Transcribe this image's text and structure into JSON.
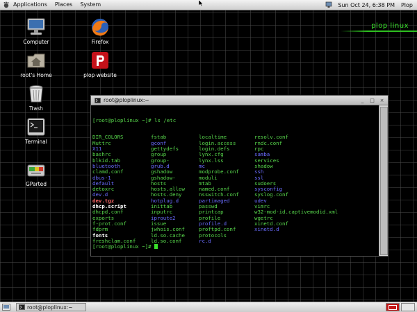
{
  "top_panel": {
    "menu": [
      "Applications",
      "Places",
      "System"
    ],
    "clock": "Sun Oct 24,  6:38 PM",
    "user": "Plop"
  },
  "desktop_icons": [
    {
      "label": "Computer"
    },
    {
      "label": "Firefox"
    },
    {
      "label": "root's Home"
    },
    {
      "label": "plop website"
    },
    {
      "label": "Trash"
    },
    {
      "label": "Terminal"
    },
    {
      "label": "GParted"
    }
  ],
  "brand": "plop linux",
  "terminal": {
    "title": "root@ploplinux:~",
    "prompt_line": "[root@ploplinux ~]# ls /etc",
    "final_prompt": "[root@ploplinux ~]# ",
    "rows": [
      [
        [
          "DIR_COLORS",
          "g"
        ],
        [
          "fstab",
          "g"
        ],
        [
          "localtime",
          "g"
        ],
        [
          "resolv.conf",
          "g"
        ]
      ],
      [
        [
          "Muttrc",
          "g"
        ],
        [
          "gconf",
          "b"
        ],
        [
          "login.access",
          "g"
        ],
        [
          "rndc.conf",
          "g"
        ]
      ],
      [
        [
          "X11",
          "b"
        ],
        [
          "gettydefs",
          "g"
        ],
        [
          "login.defs",
          "g"
        ],
        [
          "rpc",
          "g"
        ]
      ],
      [
        [
          "bashrc",
          "g"
        ],
        [
          "group",
          "g"
        ],
        [
          "lynx.cfg",
          "g"
        ],
        [
          "samba",
          "b"
        ]
      ],
      [
        [
          "blkid.tab",
          "g"
        ],
        [
          "group-",
          "g"
        ],
        [
          "lynx.lss",
          "g"
        ],
        [
          "services",
          "g"
        ]
      ],
      [
        [
          "bluetooth",
          "b"
        ],
        [
          "grub.d",
          "b"
        ],
        [
          "mc",
          "b"
        ],
        [
          "shadow",
          "g"
        ]
      ],
      [
        [
          "clamd.conf",
          "g"
        ],
        [
          "gshadow",
          "g"
        ],
        [
          "modprobe.conf",
          "g"
        ],
        [
          "ssh",
          "b"
        ]
      ],
      [
        [
          "dbus-1",
          "b"
        ],
        [
          "gshadow-",
          "g"
        ],
        [
          "moduli",
          "g"
        ],
        [
          "ssl",
          "b"
        ]
      ],
      [
        [
          "default",
          "b"
        ],
        [
          "hosts",
          "g"
        ],
        [
          "mtab",
          "g"
        ],
        [
          "sudoers",
          "g"
        ]
      ],
      [
        [
          "detoxrc",
          "g"
        ],
        [
          "hosts.allow",
          "g"
        ],
        [
          "named.conf",
          "g"
        ],
        [
          "sysconfig",
          "b"
        ]
      ],
      [
        [
          "dev.d",
          "b"
        ],
        [
          "hosts.deny",
          "g"
        ],
        [
          "nsswitch.conf",
          "g"
        ],
        [
          "syslog.conf",
          "g"
        ]
      ],
      [
        [
          "dev.tgz",
          "r"
        ],
        [
          "hotplug.d",
          "b"
        ],
        [
          "partimaged",
          "b"
        ],
        [
          "udev",
          "b"
        ]
      ],
      [
        [
          "dhcp.script",
          "w"
        ],
        [
          "inittab",
          "g"
        ],
        [
          "passwd",
          "g"
        ],
        [
          "vimrc",
          "g"
        ]
      ],
      [
        [
          "dhcpd.conf",
          "g"
        ],
        [
          "inputrc",
          "g"
        ],
        [
          "printcap",
          "g"
        ],
        [
          "w32-mod-id.captivemodid.xml",
          "g"
        ]
      ],
      [
        [
          "exports",
          "g"
        ],
        [
          "iproute2",
          "b"
        ],
        [
          "profile",
          "g"
        ],
        [
          "wgetrc",
          "g"
        ]
      ],
      [
        [
          "f-prot.conf",
          "g"
        ],
        [
          "issue",
          "g"
        ],
        [
          "profile.d",
          "b"
        ],
        [
          "xinetd.conf",
          "g"
        ]
      ],
      [
        [
          "fdprm",
          "g"
        ],
        [
          "jwhois.conf",
          "g"
        ],
        [
          "proftpd.conf",
          "g"
        ],
        [
          "xinetd.d",
          "b"
        ]
      ],
      [
        [
          "fonts",
          "w"
        ],
        [
          "ld.so.cache",
          "g"
        ],
        [
          "protocols",
          "g"
        ],
        [
          "",
          ""
        ]
      ],
      [
        [
          "freshclam.conf",
          "g"
        ],
        [
          "ld.so.conf",
          "g"
        ],
        [
          "rc.d",
          "b"
        ],
        [
          "",
          ""
        ]
      ]
    ]
  },
  "taskbar": {
    "task_label": "root@ploplinux:~"
  }
}
